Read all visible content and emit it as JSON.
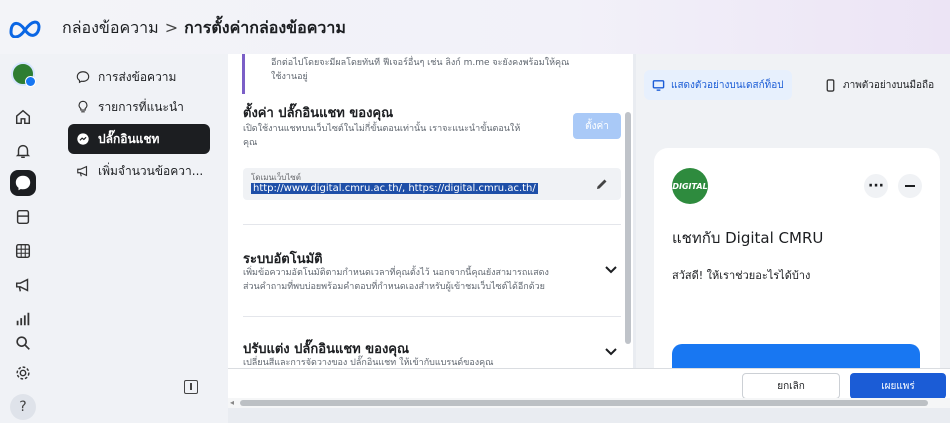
{
  "header": {
    "breadcrumb_parent": "กล่องข้อความ",
    "breadcrumb_separator": ">",
    "breadcrumb_current": "การตั้งค่ากล่องข้อความ"
  },
  "subnav": {
    "items": [
      {
        "label": "การส่งข้อความ",
        "icon": "chat-bubble-icon"
      },
      {
        "label": "รายการที่แนะนำ",
        "icon": "lightbulb-icon"
      },
      {
        "label": "ปลั๊กอินแชท",
        "icon": "messenger-icon"
      },
      {
        "label": "เพิ่มจำนวนข้อควา...",
        "icon": "megaphone-icon"
      }
    ]
  },
  "settings": {
    "info_note_line1": "อีกต่อไปโดยจะมีผลโดยทันที ฟีเจอร์อื่นๆ เช่น ลิงก์ m.me จะยังคงพร้อมให้คุณ",
    "info_note_line2": "ใช้งานอยู่",
    "plugin_title": "ตั้งค่า ปลั๊กอินแชท ของคุณ",
    "plugin_desc_line1": "เปิดใช้งานแชทบนเว็บไซต์ในไม่กี่ขั้นตอนเท่านั้น เราจะแนะนำขั้นตอนให้",
    "plugin_desc_line2": "คุณ",
    "setup_button": "ตั้งค่า",
    "domain_label": "โดเมนเว็บไซต์",
    "domain_value": "http://www.digital.cmru.ac.th/, https://digital.cmru.ac.th/",
    "automation_title": "ระบบอัตโนมัติ",
    "automation_desc_line1": "เพิ่มข้อความอัตโนมัติตามกำหนดเวลาที่คุณตั้งไว้ นอกจากนี้คุณยังสามารถแสดง",
    "automation_desc_line2": "ส่วนคำถามที่พบบ่อยพร้อมคำตอบที่กำหนดเองสำหรับผู้เข้าชมเว็บไซต์ได้อีกด้วย",
    "customize_title": "ปรับแต่ง ปลั๊กอินแชท ของคุณ",
    "customize_desc": "เปลี่ยนสีและการจัดวางของ ปลั๊กอินแชท ให้เข้ากับแบรนด์ของคุณ"
  },
  "preview": {
    "tab_desktop": "แสดงตัวอย่างบนเดสก์ท็อป",
    "tab_mobile": "ภาพตัวอย่างบนมือถือ",
    "avatar_text": "DIGITAL",
    "chat_title": "แชทกับ Digital CMRU",
    "greeting": "สวัสดี! ให้เราช่วยอะไรได้บ้าง",
    "more_icon": "more-icon"
  },
  "footer": {
    "cancel_button": "ยกเลิก",
    "publish_button": "เผยแพร่"
  },
  "colors": {
    "accent": "#1877f2",
    "publish": "#1b5cd6",
    "active_nav": "#1c1e21",
    "note_border": "#7b5fc7"
  }
}
